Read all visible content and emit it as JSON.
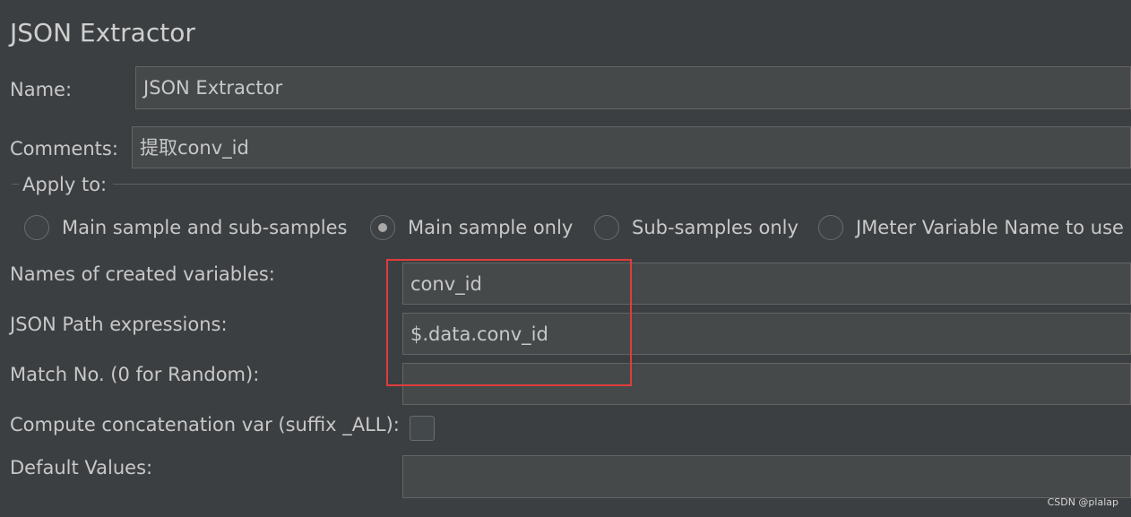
{
  "panel": {
    "title": "JSON Extractor"
  },
  "name_field": {
    "label": "Name:",
    "value": "JSON Extractor"
  },
  "comments_field": {
    "label": "Comments:",
    "value": "提取conv_id"
  },
  "apply_to": {
    "legend": "Apply to:",
    "options": [
      {
        "label": "Main sample and sub-samples",
        "selected": false
      },
      {
        "label": "Main sample only",
        "selected": true
      },
      {
        "label": "Sub-samples only",
        "selected": false
      },
      {
        "label": "JMeter Variable Name to use",
        "selected": false
      }
    ]
  },
  "form": {
    "variable_names": {
      "label": "Names of created variables:",
      "value": "conv_id"
    },
    "json_path": {
      "label": "JSON Path expressions:",
      "value": "$.data.conv_id"
    },
    "match_no": {
      "label": "Match No. (0 for Random):",
      "value": ""
    },
    "compute_concat": {
      "label": "Compute concatenation var (suffix _ALL):",
      "checked": false
    },
    "default_values": {
      "label": "Default Values:",
      "value": ""
    }
  },
  "annotation": {
    "highlight_color": "#e03c3c"
  },
  "watermark": "CSDN @plalap",
  "colors": {
    "background": "#3c3f41",
    "field_background": "#45494a",
    "field_border": "#646464",
    "text": "#c8c8c8"
  }
}
